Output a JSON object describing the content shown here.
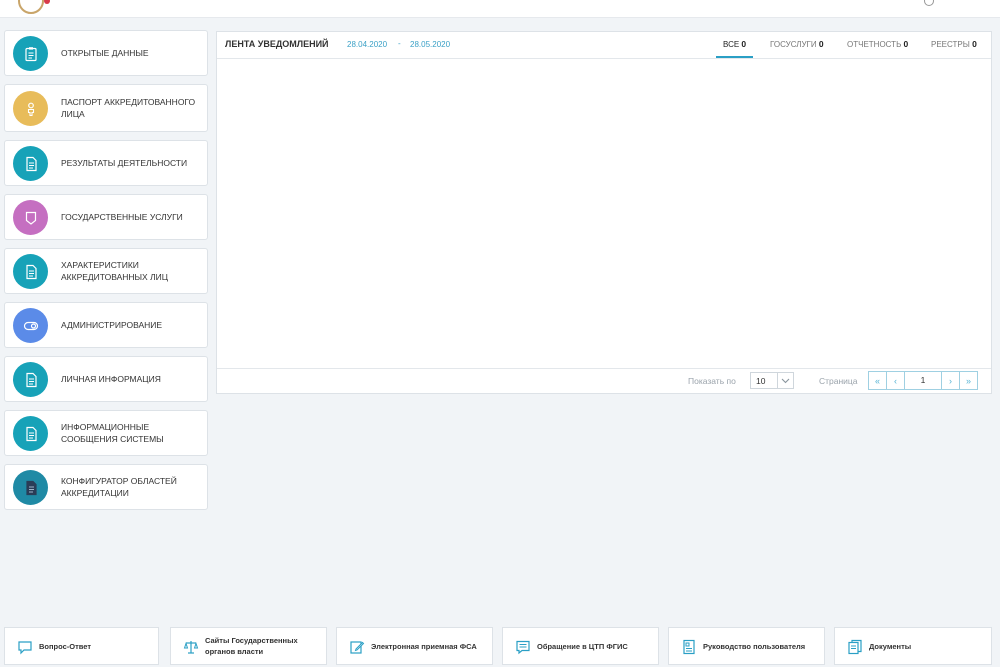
{
  "colors": {
    "teal": "#17a2b8",
    "yellow": "#e8bc5a",
    "purple": "#c56fc1",
    "blue": "#5b8be8",
    "darkteal": "#1f8aa5",
    "accent": "#2a9fc5"
  },
  "sidebar": {
    "items": [
      {
        "label": "ОТКРЫТЫЕ ДАННЫЕ",
        "icon": "clipboard-icon"
      },
      {
        "label": "ПАСПОРТ АККРЕДИТОВАННОГО ЛИЦА",
        "icon": "person-icon"
      },
      {
        "label": "РЕЗУЛЬТАТЫ ДЕЯТЕЛЬНОСТИ",
        "icon": "document-icon"
      },
      {
        "label": "ГОСУДАРСТВЕННЫЕ УСЛУГИ",
        "icon": "badge-icon"
      },
      {
        "label": "ХАРАКТЕРИСТИКИ АККРЕДИТОВАННЫХ ЛИЦ",
        "icon": "document-icon"
      },
      {
        "label": "АДМИНИСТРИРОВАНИЕ",
        "icon": "toggle-icon"
      },
      {
        "label": "ЛИЧНАЯ ИНФОРМАЦИЯ",
        "icon": "document-icon"
      },
      {
        "label": "ИНФОРМАЦИОННЫЕ СООБЩЕНИЯ СИСТЕМЫ",
        "icon": "document-icon"
      },
      {
        "label": "КОНФИГУРАТОР ОБЛАСТЕЙ АККРЕДИТАЦИИ",
        "icon": "document-icon"
      }
    ]
  },
  "feed": {
    "title": "ЛЕНТА УВЕДОМЛЕНИЙ",
    "date_from": "28.04.2020",
    "date_sep": "-",
    "date_to": "28.05.2020",
    "tabs": [
      {
        "label": "ВСЕ",
        "count": "0"
      },
      {
        "label": "ГОСУСЛУГИ",
        "count": "0"
      },
      {
        "label": "ОТЧЕТНОСТЬ",
        "count": "0"
      },
      {
        "label": "РЕЕСТРЫ",
        "count": "0"
      }
    ]
  },
  "pager": {
    "show_label": "Показать по",
    "page_size": "10",
    "page_label": "Страница",
    "page_value": "1",
    "first": "«",
    "prev": "‹",
    "next": "›",
    "last": "»"
  },
  "footer": {
    "links": [
      {
        "label": "Вопрос-Ответ",
        "icon": "chat-icon"
      },
      {
        "label": "Сайты Государственных органов власти",
        "icon": "scales-icon"
      },
      {
        "label": "Электронная приемная ФСА",
        "icon": "edit-icon"
      },
      {
        "label": "Обращение в ЦТП ФГИС",
        "icon": "message-icon"
      },
      {
        "label": "Руководство пользователя",
        "icon": "manual-icon"
      },
      {
        "label": "Документы",
        "icon": "documents-icon"
      }
    ]
  }
}
